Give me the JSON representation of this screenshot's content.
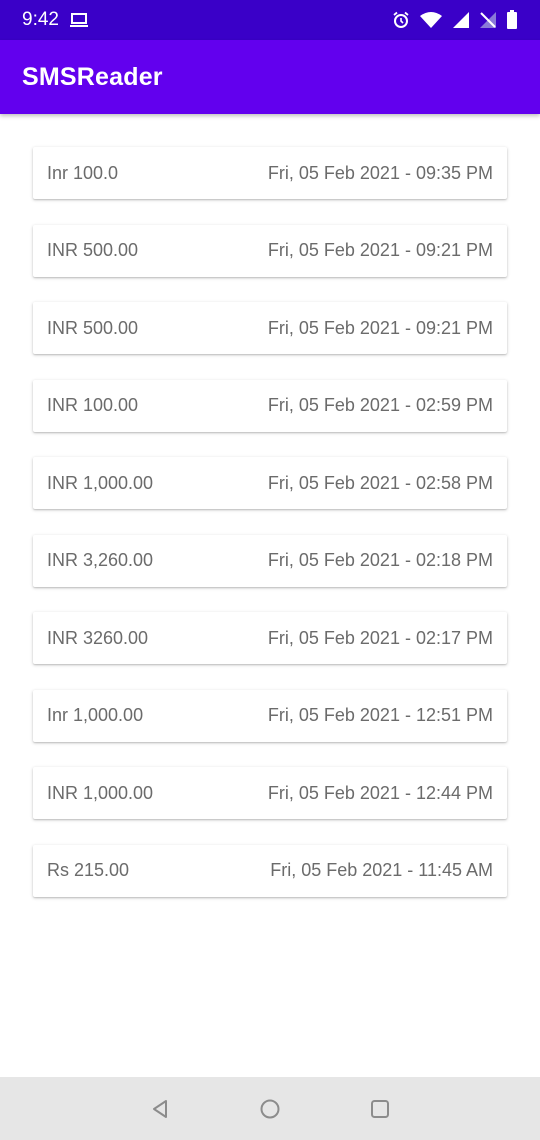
{
  "status_bar": {
    "time": "9:42",
    "icons": [
      "laptop-icon",
      "alarm-icon",
      "wifi-icon",
      "signal-icon",
      "no-sim-icon",
      "battery-icon"
    ]
  },
  "app_bar": {
    "title": "SMSReader"
  },
  "colors": {
    "status_bar": "#3a00c8",
    "app_bar": "#6200ee",
    "card_text": "#6b6b6b",
    "nav_bar": "#e6e6e6"
  },
  "messages": [
    {
      "amount": "Inr 100.0",
      "date": "Fri, 05 Feb 2021 - 09:35 PM"
    },
    {
      "amount": "INR 500.00",
      "date": "Fri, 05 Feb 2021 - 09:21 PM"
    },
    {
      "amount": "INR 500.00",
      "date": "Fri, 05 Feb 2021 - 09:21 PM"
    },
    {
      "amount": "INR 100.00",
      "date": "Fri, 05 Feb 2021 - 02:59 PM"
    },
    {
      "amount": "INR 1,000.00",
      "date": "Fri, 05 Feb 2021 - 02:58 PM"
    },
    {
      "amount": "INR 3,260.00",
      "date": "Fri, 05 Feb 2021 - 02:18 PM"
    },
    {
      "amount": "INR 3260.00",
      "date": "Fri, 05 Feb 2021 - 02:17 PM"
    },
    {
      "amount": "Inr 1,000.00",
      "date": "Fri, 05 Feb 2021 - 12:51 PM"
    },
    {
      "amount": "INR 1,000.00",
      "date": "Fri, 05 Feb 2021 - 12:44 PM"
    },
    {
      "amount": "Rs 215.00",
      "date": "Fri, 05 Feb 2021 - 11:45 AM"
    }
  ],
  "nav_bar": {
    "icons": [
      "back-icon",
      "home-icon",
      "recents-icon"
    ]
  }
}
